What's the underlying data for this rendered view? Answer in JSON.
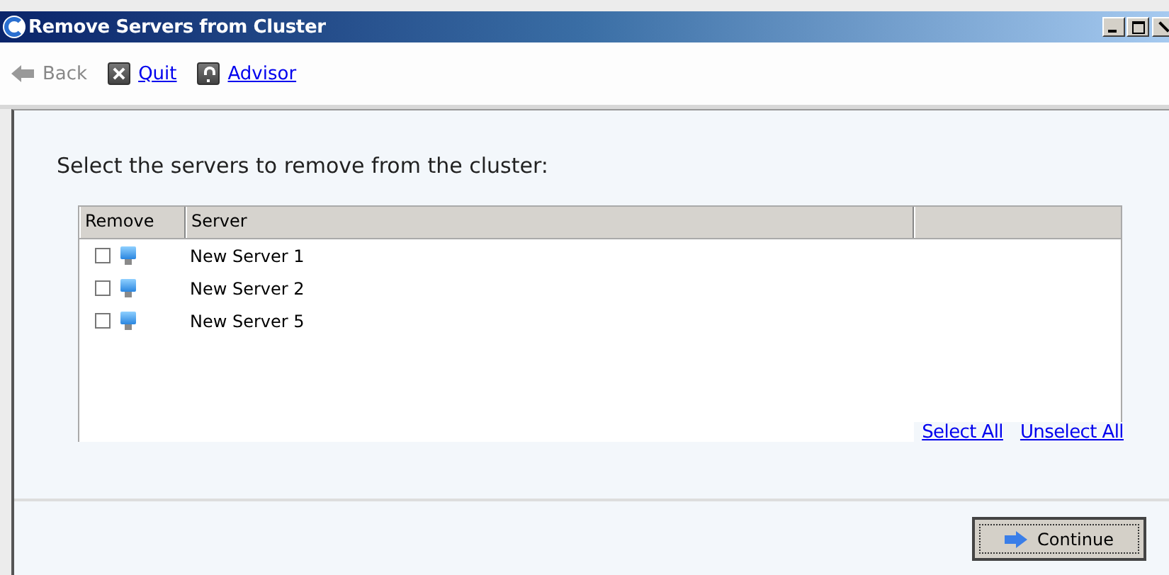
{
  "window": {
    "title": "Remove Servers from Cluster"
  },
  "toolbar": [
    {
      "kind": "back",
      "label": "Back",
      "disabled": true
    },
    {
      "kind": "quit",
      "label": "Quit",
      "disabled": false
    },
    {
      "kind": "advisor",
      "label": "Advisor",
      "disabled": false
    }
  ],
  "prompt": "Select the servers to remove from the cluster:",
  "table": {
    "columns": [
      "Remove",
      "Server"
    ],
    "rows": [
      {
        "checked": false,
        "server": "New Server 1"
      },
      {
        "checked": false,
        "server": "New Server 2"
      },
      {
        "checked": false,
        "server": "New Server 5"
      }
    ]
  },
  "links": [
    "Select All",
    "Unselect All"
  ],
  "buttons": [
    "Continue"
  ]
}
